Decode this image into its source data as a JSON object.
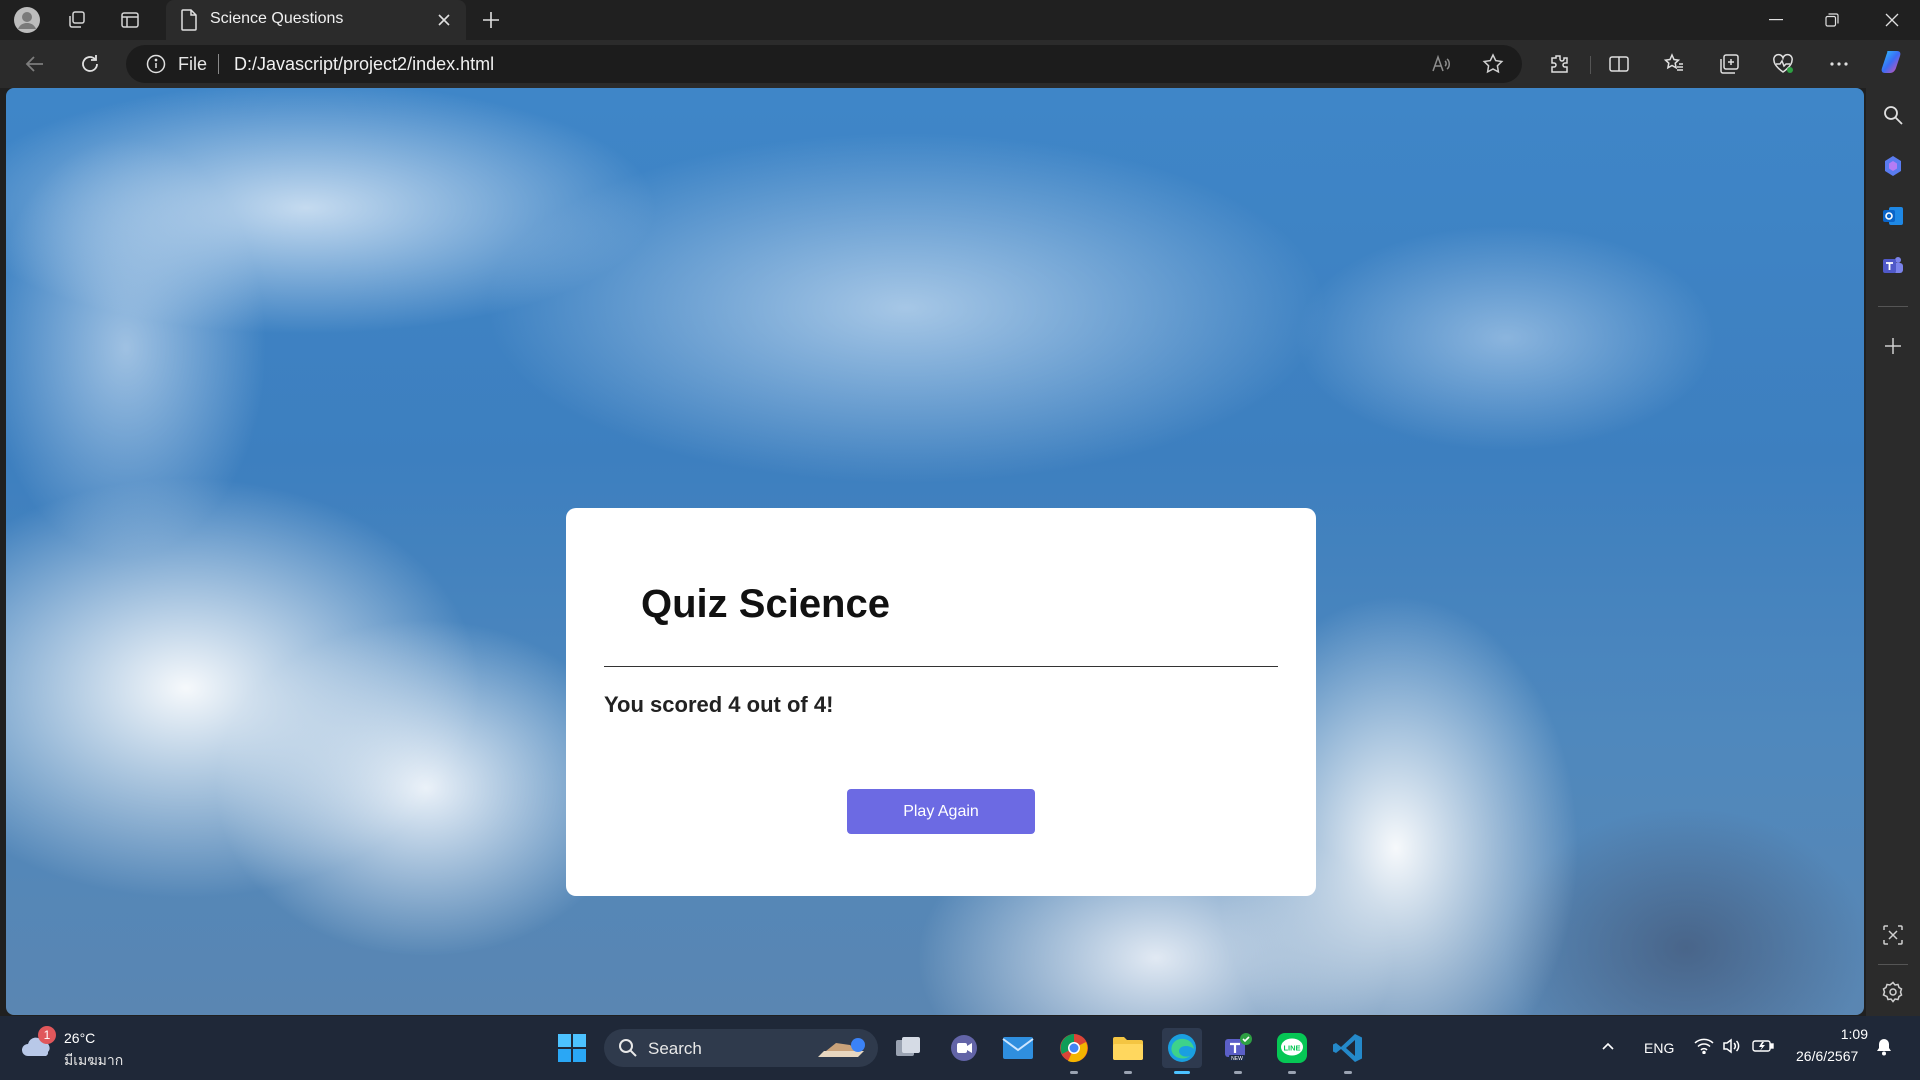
{
  "browser": {
    "tab_title": "Science Questions",
    "address_scheme": "File",
    "address_url": "D:/Javascript/project2/index.html"
  },
  "quiz": {
    "title": "Quiz Science",
    "score_text": "You scored 4 out of 4!",
    "play_again_label": "Play Again",
    "button_color": "#6c6ae3"
  },
  "taskbar": {
    "weather_temp": "26°C",
    "weather_condition": "มีเมฆมาก",
    "weather_badge": "1",
    "search_label": "Search",
    "language": "ENG",
    "time": "1:09",
    "date": "26/6/2567"
  }
}
